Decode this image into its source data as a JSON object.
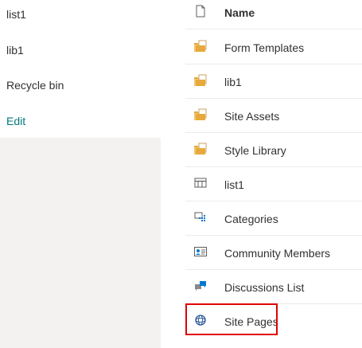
{
  "nav": {
    "items": [
      {
        "label": "list1"
      },
      {
        "label": "lib1"
      },
      {
        "label": "Recycle bin"
      }
    ],
    "edit_label": "Edit"
  },
  "list": {
    "header": {
      "label": "Name",
      "icon": "document-icon"
    },
    "rows": [
      {
        "label": "Form Templates",
        "icon": "document-library-icon"
      },
      {
        "label": "lib1",
        "icon": "document-library-icon"
      },
      {
        "label": "Site Assets",
        "icon": "document-library-icon"
      },
      {
        "label": "Style Library",
        "icon": "document-library-icon"
      },
      {
        "label": "list1",
        "icon": "list-icon"
      },
      {
        "label": "Categories",
        "icon": "categories-icon"
      },
      {
        "label": "Community Members",
        "icon": "contact-card-icon"
      },
      {
        "label": "Discussions List",
        "icon": "discussion-icon"
      },
      {
        "label": "Site Pages",
        "icon": "site-pages-icon"
      }
    ],
    "highlighted_row": "Site Pages"
  },
  "colors": {
    "nav_background": "#f3f2f1",
    "edit_link": "#03787c",
    "highlight_border": "#e00000",
    "folder_icon": "#e8a93c"
  }
}
